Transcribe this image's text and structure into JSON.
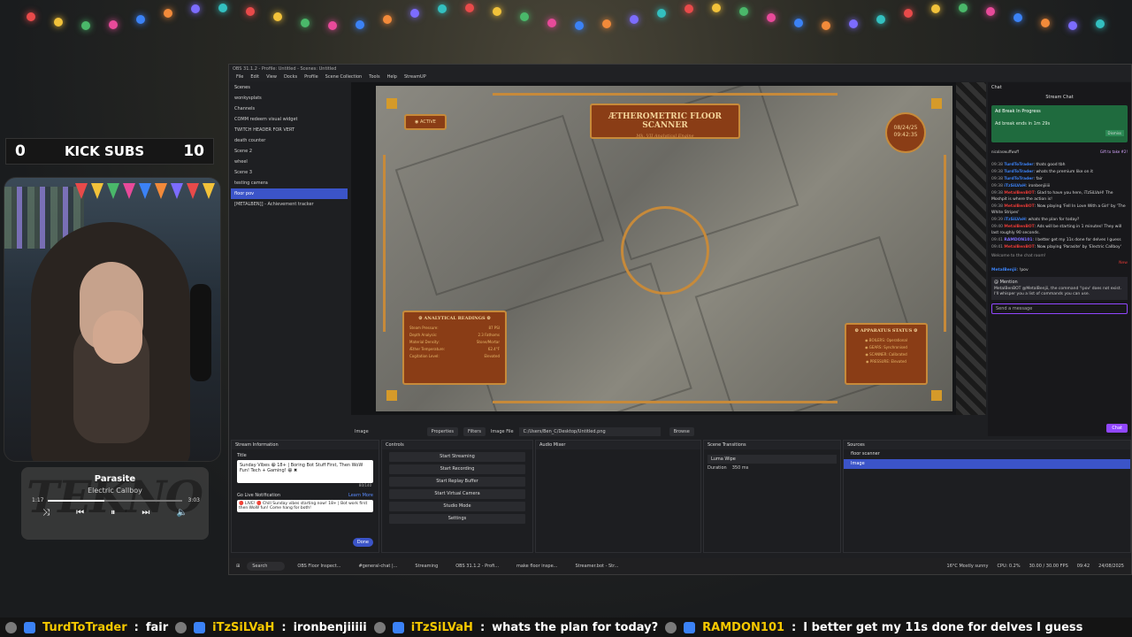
{
  "overlay": {
    "kick_left": "0",
    "kick_label": "KICK SUBS",
    "kick_right": "10",
    "music_title": "Parasite",
    "music_artist": "Electric Callboy",
    "music_elapsed": "1:17",
    "music_total": "3:03",
    "music_watermark": "TEKNO",
    "music_progress": 0.42
  },
  "obs": {
    "titlebar": "OBS 31.1.2 - Profile: Untitled - Scenes: Untitled",
    "menu": [
      "File",
      "Edit",
      "View",
      "Docks",
      "Profile",
      "Scene Collection",
      "Tools",
      "Help",
      "StreamUP"
    ],
    "scenes_header": "Scenes",
    "scenes": [
      "wonkysplats",
      "Channels",
      "COMM redeem visual widget",
      "TWITCH HEADER FOR VERT",
      "death counter",
      "Scene 2",
      "wheel",
      "Scene 3",
      "testing camera",
      "floor pov",
      "[METALBEN]] - Achievement tracker"
    ],
    "active_scene_index": 9,
    "hud": {
      "title": "ÆTHEROMETRIC FLOOR SCANNER",
      "subtitle": "Mk. VII Analytical Engine",
      "active": "◉ ACTIVE",
      "date": "08/24/25",
      "time": "09:42:35",
      "analytical_header": "⚙ ANALYTICAL READINGS ⚙",
      "readings": [
        {
          "k": "Steam Pressure:",
          "v": "87 PSI"
        },
        {
          "k": "Depth Analysis:",
          "v": "2.3 Fathoms"
        },
        {
          "k": "Material Density:",
          "v": "Stone/Mortar"
        },
        {
          "k": "Æther Temperature:",
          "v": "62.4°F"
        },
        {
          "k": "Cogitation Level:",
          "v": "Elevated"
        }
      ],
      "apparatus_header": "⚙ APPARATUS STATUS ⚙",
      "apparatus": [
        "◉ BOILERS: Operational",
        "◉ GEARS: Synchronised",
        "◉ SCANNER: Calibrated",
        "◉ PRESSURE: Elevated"
      ]
    },
    "ctx": {
      "source": "Image",
      "properties": "Properties",
      "filters": "Filters",
      "image_file_label": "Image File",
      "image_file": "C:/Users/Ben_C/Desktop/Untitled.png",
      "browse": "Browse"
    },
    "chat": {
      "dock_title": "Chat",
      "title": "Stream Chat",
      "ad_title": "Ad Break In Progress",
      "ad_body": "Ad break ends in 1m 29s",
      "dismiss": "Dismiss",
      "gift_user": "nicolaswuffwuff",
      "gift_text": "Gift to take #2!",
      "messages": [
        {
          "ts": "09:38",
          "name": "TurdToTrader",
          "cls": "n1",
          "text": ": thats good tbh"
        },
        {
          "ts": "09:38",
          "name": "TurdToTrader",
          "cls": "n1",
          "text": ": whats the premium like on it"
        },
        {
          "ts": "09:38",
          "name": "TurdToTrader",
          "cls": "n1",
          "text": ": fair"
        },
        {
          "ts": "09:38",
          "name": "iTzSiLVaH",
          "cls": "n1",
          "text": ": ironbenjiiiii"
        },
        {
          "ts": "09:38",
          "name": "MetalBenBOT",
          "cls": "n2",
          "text": ": Glad to have you here, iTzSiLVaH! The Moshpit is where the action is!"
        },
        {
          "ts": "09:38",
          "name": "MetalBenBOT",
          "cls": "n2",
          "text": ": Now playing 'Fell In Love With a Girl' by 'The White Stripes'"
        },
        {
          "ts": "09:39",
          "name": "iTzSiLVaH",
          "cls": "n1",
          "text": ": whats the plan for today?"
        },
        {
          "ts": "09:40",
          "name": "MetalBenBOT",
          "cls": "n2",
          "text": ": Ads will be starting in 1 minutes! They will last roughly 90 seconds."
        },
        {
          "ts": "09:41",
          "name": "RAMDON101",
          "cls": "n3",
          "text": ": I better get my 11s done for delves I guess"
        },
        {
          "ts": "09:41",
          "name": "MetalBenBOT",
          "cls": "n2",
          "text": ": Now playing 'Parasite' by 'Electric Callboy'"
        }
      ],
      "welcome": "Welcome to the chat room!",
      "new_label": "New",
      "last_user": "MetalBenjii",
      "last_text": ": !pov",
      "mention_header": "@ Mention",
      "mention_text": "MetalBenBOT @MetalBenjii, the command '!pov' does not exist. I'll whisper you a list of commands you can use.",
      "send_placeholder": "Send a message",
      "chat_button": "Chat"
    },
    "stream_info": {
      "header": "Stream Information",
      "title_label": "Title",
      "title_value": "Sunday Vibes 😁 18+ | Boring Bot Stuff First, Then WoW Fun! Tech + Gaming! 😁 ✖",
      "count": "80/140",
      "golive_label": "Go Live Notification",
      "learn_more": "Learn More",
      "golive_value": "🔴 LIVE! 🔴 Chill Sunday vibes starting now! 18+ | Bot work first then WoW fun! Come hang for both!",
      "done": "Done"
    },
    "controls": {
      "header": "Controls",
      "buttons": [
        "Start Streaming",
        "Start Recording",
        "Start Replay Buffer",
        "Start Virtual Camera",
        "Studio Mode",
        "Settings"
      ]
    },
    "audio_header": "Audio Mixer",
    "transitions": {
      "header": "Scene Transitions",
      "selected": "Luma Wipe",
      "duration_label": "Duration",
      "duration_value": "350 ms"
    },
    "sources": {
      "header": "Sources",
      "items": [
        "floor scanner",
        "Image"
      ],
      "active_index": 1
    },
    "taskbar": {
      "search": "Search",
      "items": [
        "OBS Floor Inspect...",
        "#general-chat |...",
        "Streaming",
        "OBS 31.1.2 - Profi...",
        "make floor inspe...",
        "Streamer.bot - Str..."
      ],
      "weather": "16°C Mostly sunny",
      "time": "09:42",
      "date": "24/08/2025",
      "cpu": "CPU: 0.2%",
      "fps": "30.00 / 30.00 FPS"
    }
  },
  "ticker": [
    {
      "user": "TurdToTrader",
      "msg": "fair"
    },
    {
      "user": "iTzSiLVaH",
      "msg": "ironbenjiiiii"
    },
    {
      "user": "iTzSiLVaH",
      "msg": "whats the plan for today?"
    },
    {
      "user": "RAMDON101",
      "msg": "I better get my 11s done for delves I guess"
    }
  ]
}
